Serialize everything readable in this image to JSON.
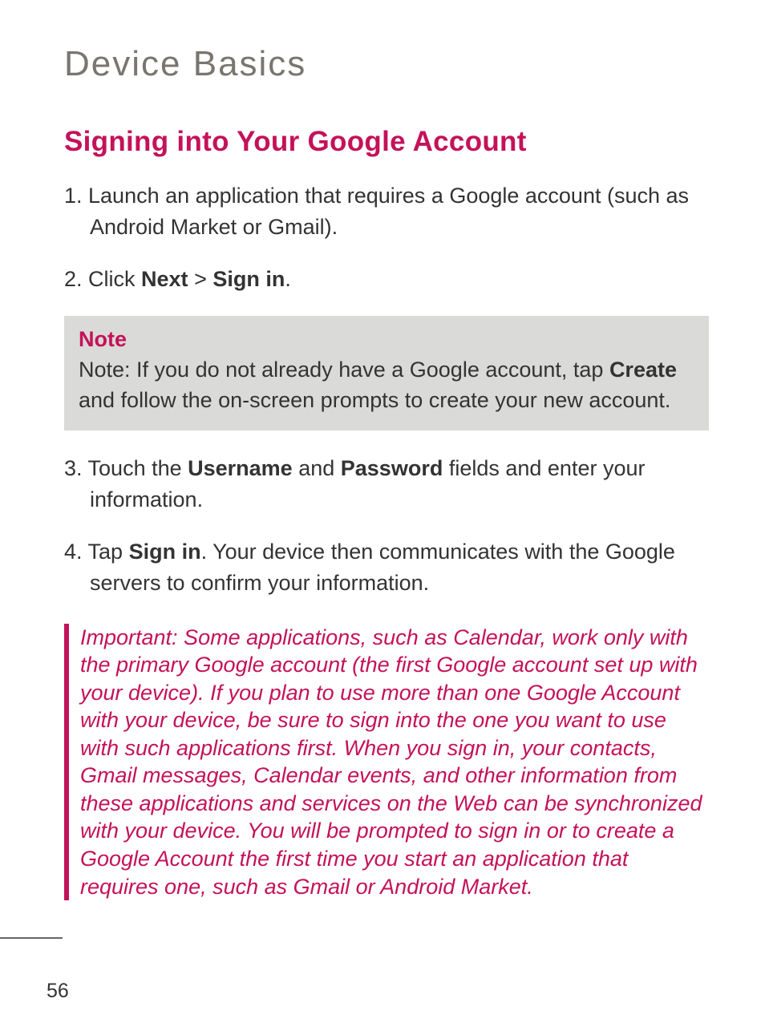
{
  "page": {
    "title": "Device Basics",
    "number": "56"
  },
  "section": {
    "heading": "Signing into Your Google Account"
  },
  "steps": {
    "s1_prefix": "1. Launch an application that requires a Google account (such as Android Market or Gmail).",
    "s2_prefix": "2. Click ",
    "s2_bold1": "Next",
    "s2_mid": " > ",
    "s2_bold2": "Sign in",
    "s2_suffix": ".",
    "s3_prefix": "3. Touch the ",
    "s3_bold1": "Username",
    "s3_mid": " and ",
    "s3_bold2": "Password",
    "s3_suffix": " fields and enter your information.",
    "s4_prefix": "4. Tap ",
    "s4_bold1": "Sign in",
    "s4_suffix": ". Your device then communicates with the Google servers to confirm your information."
  },
  "note": {
    "title": "Note",
    "body_prefix": "Note: If you do not already have a Google account, tap ",
    "body_bold": "Create",
    "body_suffix": " and follow the on-screen prompts to create your new account."
  },
  "important": {
    "text": "Important: Some applications, such as Calendar, work only with the primary Google account (the first Google account set up with your device). If you plan to use more than one Google Account with your device, be sure to sign into the one you want to use with such applications first. When you sign in, your contacts, Gmail messages, Calendar events, and other information from these applications and services on the Web can be synchronized with your device. You will be prompted to sign in or to create a Google Account the first time you start an application that requires one, such as Gmail or Android Market."
  }
}
